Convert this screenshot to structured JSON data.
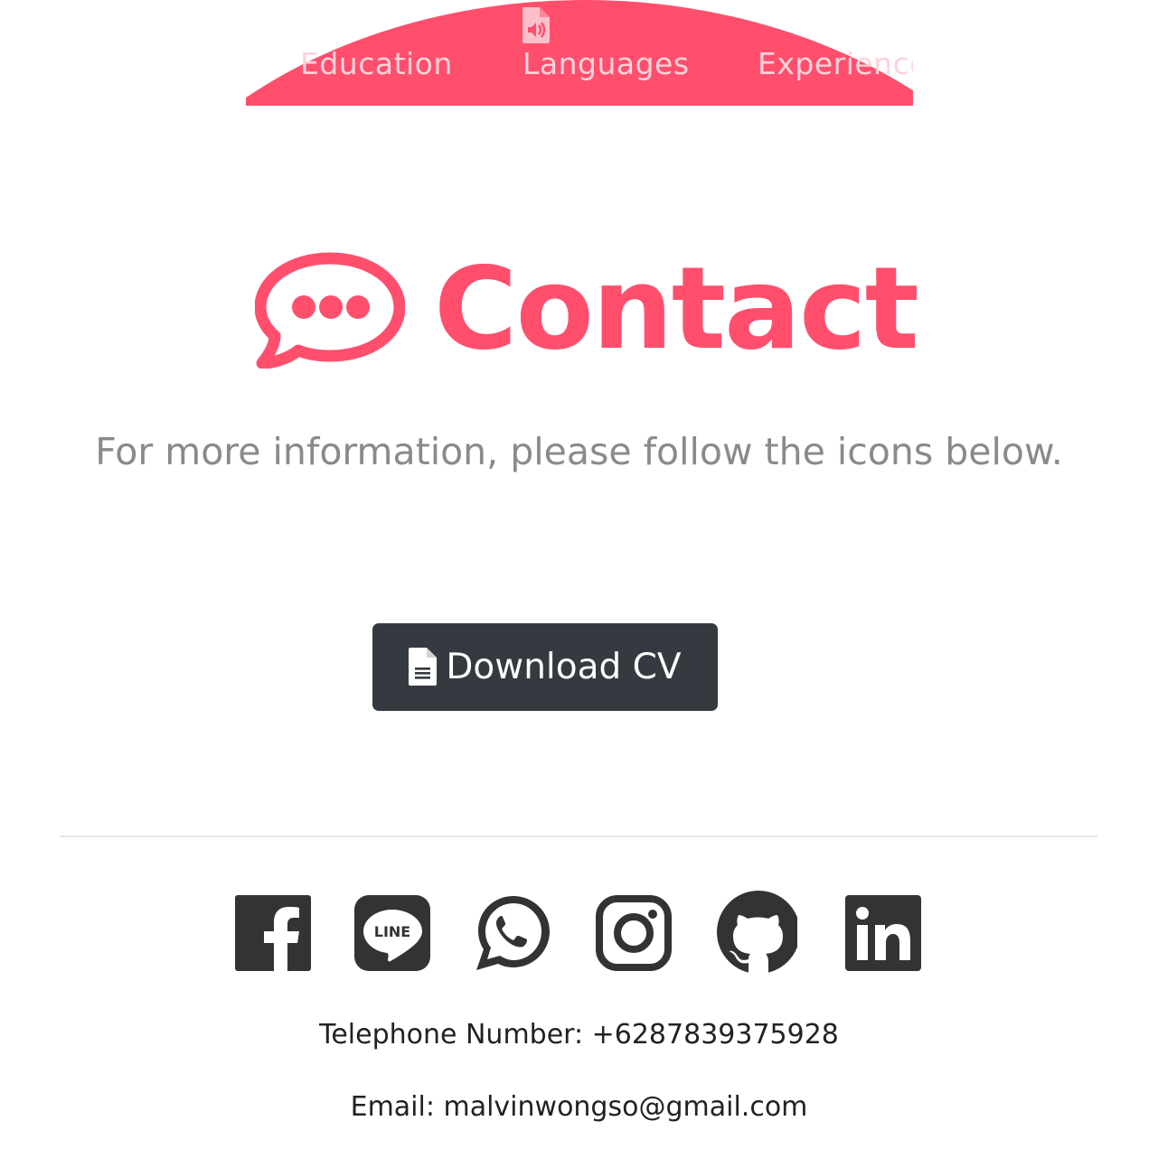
{
  "nav": {
    "items": [
      {
        "label": "Education",
        "icon": "graduation-icon"
      },
      {
        "label": "Languages",
        "icon": "file-audio-icon"
      },
      {
        "label": "Experience",
        "icon": "briefcase-icon"
      }
    ],
    "background_color": "#ff4f6d",
    "text_color": "#fcd3da"
  },
  "contact": {
    "title": "Contact",
    "icon": "chat-bubble-icon",
    "subtitle": "For more information, please follow the icons below.",
    "accent_color": "#ff4f6d"
  },
  "download": {
    "label": "Download CV",
    "icon": "file-icon",
    "background_color": "#343a40"
  },
  "social": [
    {
      "name": "Facebook",
      "icon": "facebook-icon"
    },
    {
      "name": "LINE",
      "icon": "line-icon",
      "badge_text": "LINE"
    },
    {
      "name": "WhatsApp",
      "icon": "whatsapp-icon"
    },
    {
      "name": "Instagram",
      "icon": "instagram-icon"
    },
    {
      "name": "GitHub",
      "icon": "github-icon"
    },
    {
      "name": "LinkedIn",
      "icon": "linkedin-icon"
    }
  ],
  "info": {
    "telephone": "Telephone Number: +6287839375928",
    "email": "Email: malvinwongso@gmail.com"
  }
}
